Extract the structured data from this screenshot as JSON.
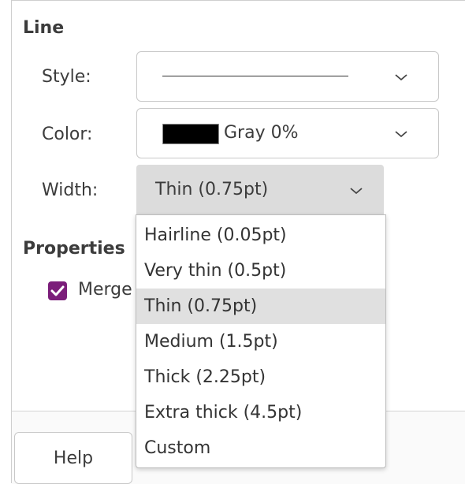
{
  "sections": {
    "line_title": "Line",
    "properties_title": "Properties"
  },
  "style": {
    "label": "Style:",
    "value": "solid-line"
  },
  "color": {
    "label": "Color:",
    "swatch_hex": "#000000",
    "value": "Gray 0%"
  },
  "width": {
    "label": "Width:",
    "value": "Thin (0.75pt)",
    "options": [
      "Hairline (0.05pt)",
      "Very thin (0.5pt)",
      "Thin (0.75pt)",
      "Medium (1.5pt)",
      "Thick (2.25pt)",
      "Extra thick (4.5pt)",
      "Custom"
    ],
    "selected_index": 2
  },
  "properties": {
    "merge_label": "Merge",
    "merge_checked": true
  },
  "buttons": {
    "help_label": "Help"
  },
  "icons": {
    "chevron": "chevron-down-icon",
    "check": "check-icon"
  },
  "colors": {
    "accent": "#7b1e7a",
    "selected_item_bg": "#e0e0e0",
    "width_button_bg": "#dcdcdc"
  }
}
